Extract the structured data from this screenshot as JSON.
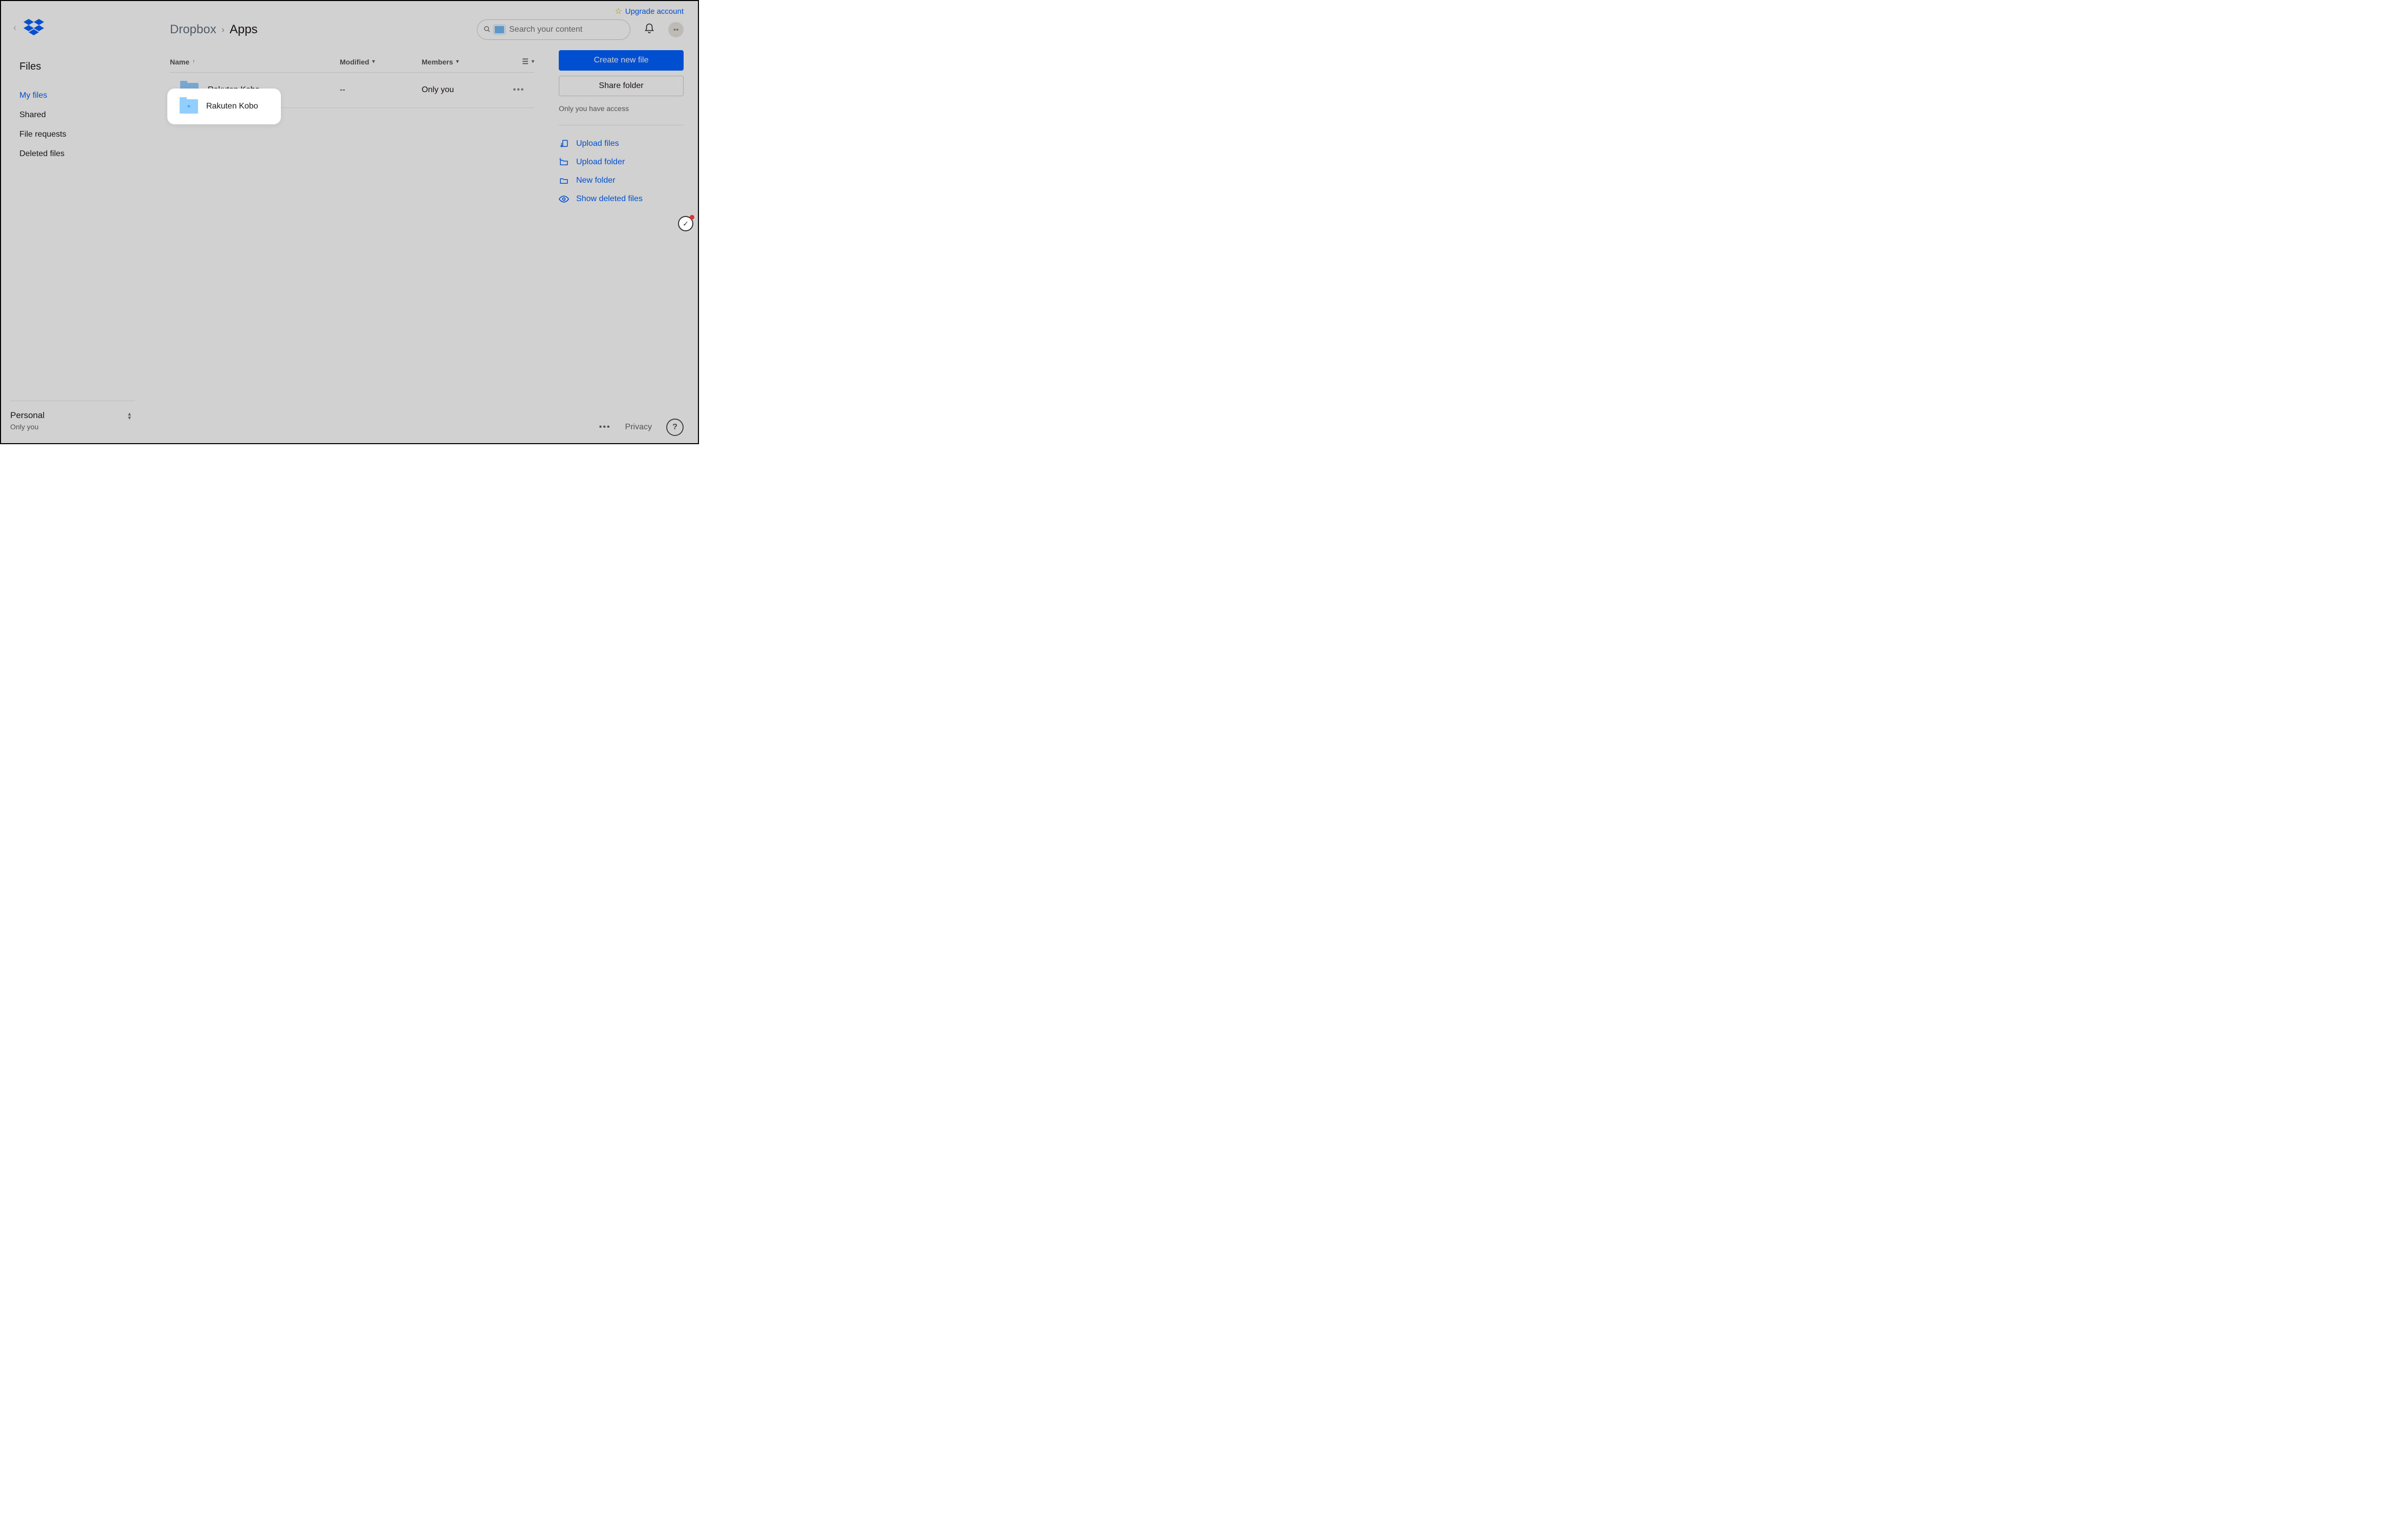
{
  "topbar": {
    "upgrade": "Upgrade account"
  },
  "sidebar": {
    "section_title": "Files",
    "items": [
      "My files",
      "Shared",
      "File requests",
      "Deleted files"
    ],
    "active_index": 0,
    "account": {
      "name": "Personal",
      "sub": "Only you"
    }
  },
  "breadcrumb": {
    "root": "Dropbox",
    "current": "Apps"
  },
  "search": {
    "placeholder": "Search your content"
  },
  "columns": {
    "name": "Name",
    "modified": "Modified",
    "members": "Members"
  },
  "rows": [
    {
      "name": "Rakuten Kobo",
      "modified": "--",
      "members": "Only you"
    }
  ],
  "right": {
    "create": "Create new file",
    "share": "Share folder",
    "access": "Only you have access",
    "actions": [
      "Upload files",
      "Upload folder",
      "New folder",
      "Show deleted files"
    ]
  },
  "footer": {
    "privacy": "Privacy"
  }
}
